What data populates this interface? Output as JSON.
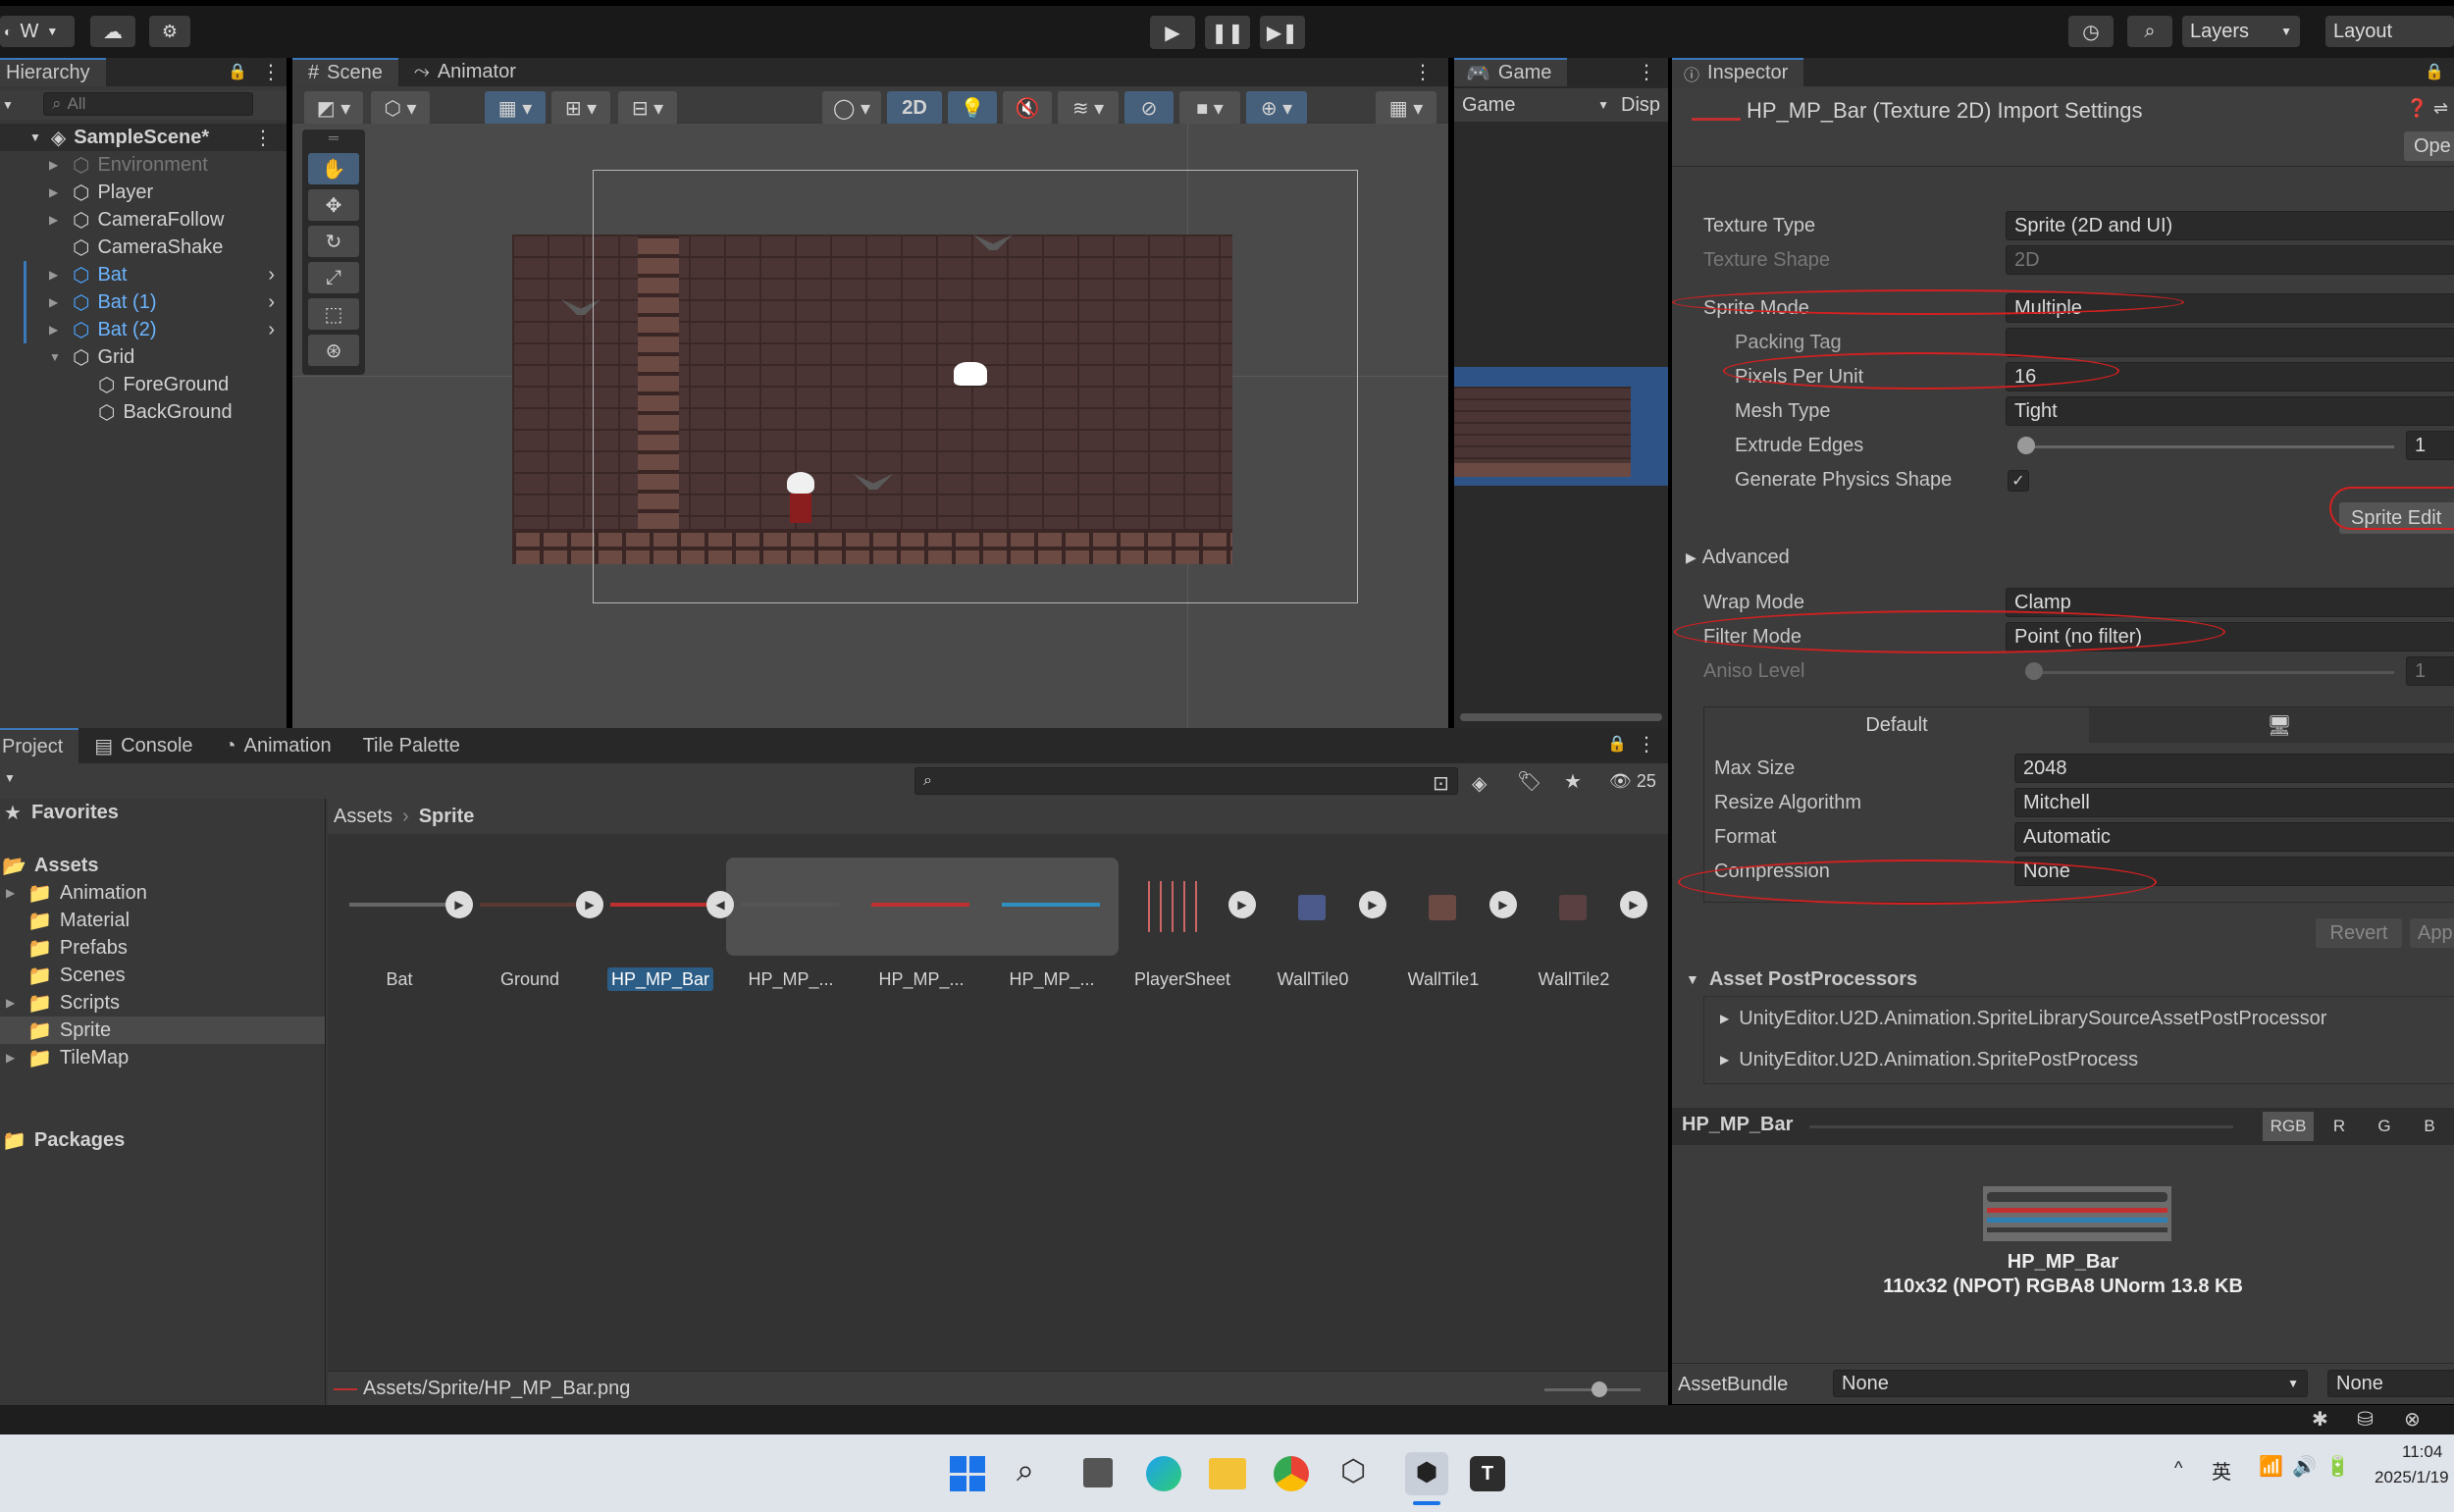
{
  "toolbar": {
    "account": "W",
    "layers": "Layers",
    "layout": "Layout"
  },
  "hierarchy": {
    "tab": "Hierarchy",
    "search_placeholder": "All",
    "scene": "SampleScene*",
    "items": [
      {
        "label": "Environment",
        "dim": true
      },
      {
        "label": "Player"
      },
      {
        "label": "CameraFollow"
      },
      {
        "label": "CameraShake"
      },
      {
        "label": "Bat",
        "blue": true
      },
      {
        "label": "Bat (1)",
        "blue": true
      },
      {
        "label": "Bat (2)",
        "blue": true
      },
      {
        "label": "Grid"
      },
      {
        "label": "ForeGround"
      },
      {
        "label": "BackGround"
      }
    ]
  },
  "scene": {
    "tab_scene": "Scene",
    "tab_animator": "Animator",
    "mode_2d": "2D"
  },
  "game": {
    "tab": "Game",
    "display": "Game",
    "disp": "Disp"
  },
  "inspector": {
    "tab": "Inspector",
    "title": "HP_MP_Bar (Texture 2D) Import Settings",
    "open": "Ope",
    "texture_type": {
      "label": "Texture Type",
      "value": "Sprite (2D and UI)"
    },
    "texture_shape": {
      "label": "Texture Shape",
      "value": "2D"
    },
    "sprite_mode": {
      "label": "Sprite Mode",
      "value": "Multiple"
    },
    "packing_tag": {
      "label": "Packing Tag",
      "value": ""
    },
    "ppu": {
      "label": "Pixels Per Unit",
      "value": "16"
    },
    "mesh_type": {
      "label": "Mesh Type",
      "value": "Tight"
    },
    "extrude": {
      "label": "Extrude Edges",
      "value": "1"
    },
    "physics": {
      "label": "Generate Physics Shape"
    },
    "sprite_editor": "Sprite Edit",
    "advanced": "Advanced",
    "wrap": {
      "label": "Wrap Mode",
      "value": "Clamp"
    },
    "filter": {
      "label": "Filter Mode",
      "value": "Point (no filter)"
    },
    "aniso": {
      "label": "Aniso Level",
      "value": "1"
    },
    "platform_default": "Default",
    "max_size": {
      "label": "Max Size",
      "value": "2048"
    },
    "resize": {
      "label": "Resize Algorithm",
      "value": "Mitchell"
    },
    "format": {
      "label": "Format",
      "value": "Automatic"
    },
    "compression": {
      "label": "Compression",
      "value": "None"
    },
    "revert": "Revert",
    "apply": "Appl",
    "postprocessors": "Asset PostProcessors",
    "pp1": "UnityEditor.U2D.Animation.SpriteLibrarySourceAssetPostProcessor",
    "pp2": "UnityEditor.U2D.Animation.SpritePostProcess",
    "preview_name": "HP_MP_Bar",
    "ch_rgb": "RGB",
    "ch_r": "R",
    "ch_g": "G",
    "ch_b": "B",
    "preview_caption": "HP_MP_Bar",
    "preview_info": "110x32 (NPOT)  RGBA8 UNorm  13.8 KB",
    "assetbundle": "AssetBundle",
    "ab_value": "None",
    "ab_variant": "None"
  },
  "project": {
    "tabs": [
      "Project",
      "Console",
      "Animation",
      "Tile Palette"
    ],
    "count": "25",
    "favorites": "Favorites",
    "assets": "Assets",
    "folders": [
      "Animation",
      "Material",
      "Prefabs",
      "Scenes",
      "Scripts",
      "Sprite",
      "TileMap"
    ],
    "packages": "Packages",
    "crumb_root": "Assets",
    "crumb_leaf": "Sprite",
    "files": [
      "Bat",
      "Ground",
      "HP_MP_Bar",
      "HP_MP_...",
      "HP_MP_...",
      "HP_MP_...",
      "PlayerSheet",
      "WallTile0",
      "WallTile1",
      "WallTile2"
    ],
    "path": "Assets/Sprite/HP_MP_Bar.png"
  },
  "taskbar": {
    "ime": "英",
    "time": "11:04",
    "date": "2025/1/19"
  },
  "colors": {
    "accent": "#3a79bb",
    "ring": "#d42020",
    "panel": "#383838"
  }
}
